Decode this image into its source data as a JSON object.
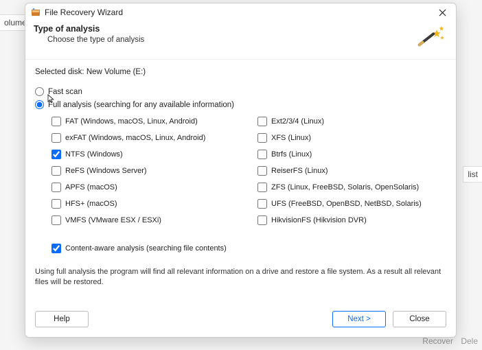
{
  "bg": {
    "left": "olume (E:",
    "right": "list",
    "recover": "Recover",
    "del": "Dele"
  },
  "titlebar": {
    "title": "File Recovery Wizard"
  },
  "header": {
    "heading": "Type of analysis",
    "sub": "Choose the type of analysis"
  },
  "body": {
    "selected_disk_label": "Selected disk:",
    "selected_disk_value": "New Volume (E:)",
    "fast_scan_label": "Fast scan",
    "full_analysis_label": "Full analysis (searching for any available information)",
    "fs_left": [
      "FAT (Windows, macOS, Linux, Android)",
      "exFAT (Windows, macOS, Linux, Android)",
      "NTFS (Windows)",
      "ReFS (Windows Server)",
      "APFS (macOS)",
      "HFS+ (macOS)",
      "VMFS (VMware ESX / ESXi)"
    ],
    "fs_right": [
      "Ext2/3/4 (Linux)",
      "XFS (Linux)",
      "Btrfs (Linux)",
      "ReiserFS (Linux)",
      "ZFS (Linux, FreeBSD, Solaris, OpenSolaris)",
      "UFS (FreeBSD, OpenBSD, NetBSD, Solaris)",
      "HikvisionFS (Hikvision DVR)"
    ],
    "content_aware_label": "Content-aware analysis (searching file contents)",
    "description": "Using full analysis the program will find all relevant information on a drive and restore a file system. As a result all relevant files will be restored."
  },
  "footer": {
    "help": "Help",
    "next": "Next >",
    "close": "Close"
  }
}
